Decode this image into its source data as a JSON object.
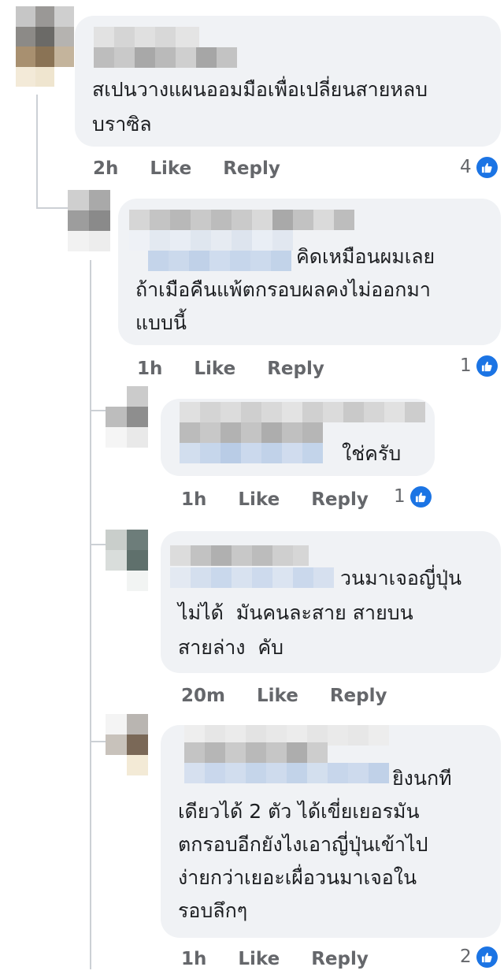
{
  "comments": [
    {
      "text_lines": [
        "สเปนวางแผนออมมือเพื่อเปลี่ยนสายหลบ",
        "บราซิล"
      ],
      "time": "2h",
      "like_label": "Like",
      "reply_label": "Reply",
      "reactions": "4",
      "reaction_icon": "thumbs-up-icon"
    },
    {
      "text_lines": [
        "คิดเหมือนผมเลย",
        "ถ้าเมือคืนแพ้ตกรอบผลคงไม่ออกมา",
        "แบบนี้"
      ],
      "time": "1h",
      "like_label": "Like",
      "reply_label": "Reply",
      "reactions": "1",
      "reaction_icon": "thumbs-up-icon"
    },
    {
      "text_lines": [
        "ใช่ครับ"
      ],
      "time": "1h",
      "like_label": "Like",
      "reply_label": "Reply",
      "reactions": "1",
      "reaction_icon": "thumbs-up-icon"
    },
    {
      "text_lines": [
        "วนมาเจอญี่ปุ่น",
        "ไม่ได้  มันคนละสาย สายบน",
        "สายล่าง  คับ"
      ],
      "time": "20m",
      "like_label": "Like",
      "reply_label": "Reply"
    },
    {
      "text_lines": [
        "ยิงนกที",
        "เดียวได้ 2 ตัว ได้เขี่ยเยอรมัน",
        "ตกรอบอีกยังไงเอาญี่ปุ่นเข้าไป",
        "ง่ายกว่าเยอะเผื่อวนมาเจอใน",
        "รอบลึกๆ"
      ],
      "time": "1h",
      "like_label": "Like",
      "reply_label": "Reply",
      "reactions": "2",
      "reaction_icon": "thumbs-up-icon"
    }
  ],
  "colors": {
    "bubble": "#f0f2f5",
    "meta_text": "#65676b",
    "like_blue": "#1b74e4",
    "thread_line": "#ccd0d5"
  }
}
